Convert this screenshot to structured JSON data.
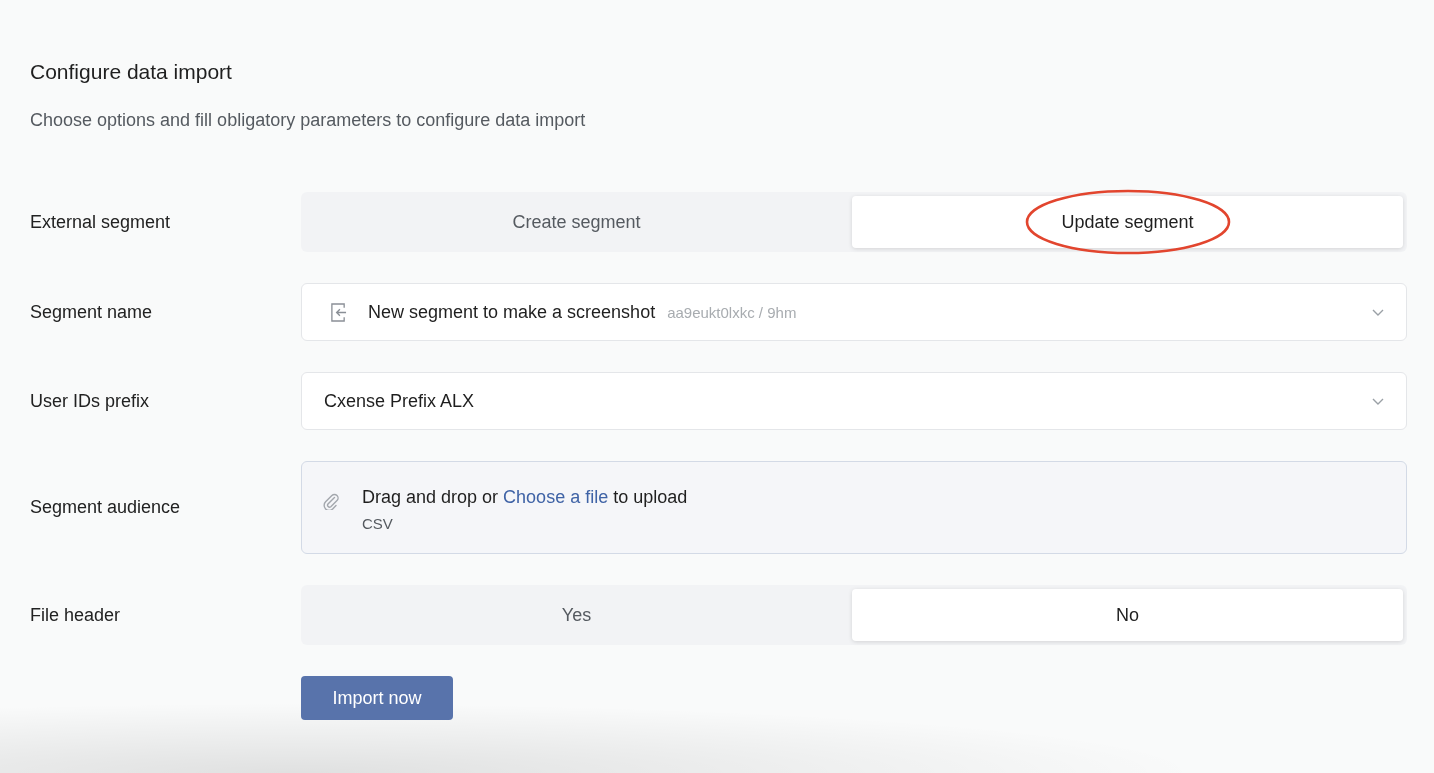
{
  "page": {
    "title": "Configure data import",
    "subtitle": "Choose options and fill obligatory parameters to configure data import"
  },
  "fields": [
    {
      "label": "External segment",
      "kind": "toggle",
      "options": [
        {
          "label": "Create segment",
          "selected": false,
          "circled": false
        },
        {
          "label": "Update segment",
          "selected": true,
          "circled": true
        }
      ]
    },
    {
      "label": "Segment name",
      "kind": "select",
      "has_icon": true,
      "value": "New segment to make a screenshot",
      "detail": "aa9eukt0lxkc / 9hm"
    },
    {
      "label": "User IDs prefix",
      "kind": "select",
      "has_icon": false,
      "value": "Cxense Prefix ALX"
    },
    {
      "label": "Segment audience",
      "kind": "upload",
      "text_before": "Drag and drop or",
      "link": "Choose a file",
      "text_after": "to upload",
      "formats": "CSV"
    },
    {
      "label": "File header",
      "kind": "toggle",
      "options": [
        {
          "label": "Yes",
          "selected": false,
          "circled": false
        },
        {
          "label": "No",
          "selected": true,
          "circled": false
        }
      ]
    }
  ],
  "submit": {
    "label": "Import now"
  }
}
